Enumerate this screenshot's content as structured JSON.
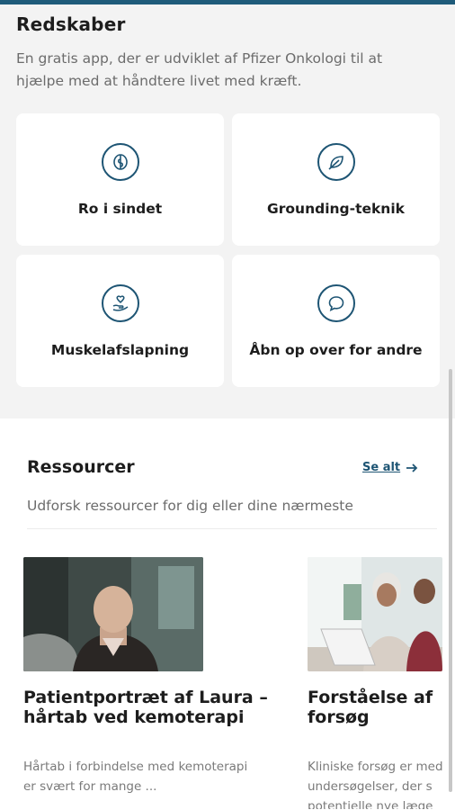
{
  "tools": {
    "title": "Redskaber",
    "description": "En gratis app, der er udviklet af Pfizer Onkologi til at hjælpe med at håndtere livet med kræft.",
    "cards": [
      {
        "label": "Ro i sindet",
        "icon": "mind-icon"
      },
      {
        "label": "Grounding-teknik",
        "icon": "leaf-icon"
      },
      {
        "label": "Muskelafslapning",
        "icon": "hand-heart-icon"
      },
      {
        "label": "Åbn op over for andre",
        "icon": "chat-bubble-icon"
      }
    ]
  },
  "resources": {
    "title": "Ressourcer",
    "see_all": "Se alt",
    "description": "Udforsk ressourcer for dig eller dine nærmeste",
    "items": [
      {
        "title": "Patientportræt af Laura – hårtab ved kemoterapi",
        "text": "Hårtab i forbindelse med kemoterapi er svært for mange ..."
      },
      {
        "title": "Forståelse af forsøg",
        "text": "Kliniske forsøg er med undersøgelser, der s potentielle nye læge"
      }
    ]
  },
  "colors": {
    "accent": "#1e5574",
    "background": "#f3f3f3",
    "card": "#ffffff"
  }
}
